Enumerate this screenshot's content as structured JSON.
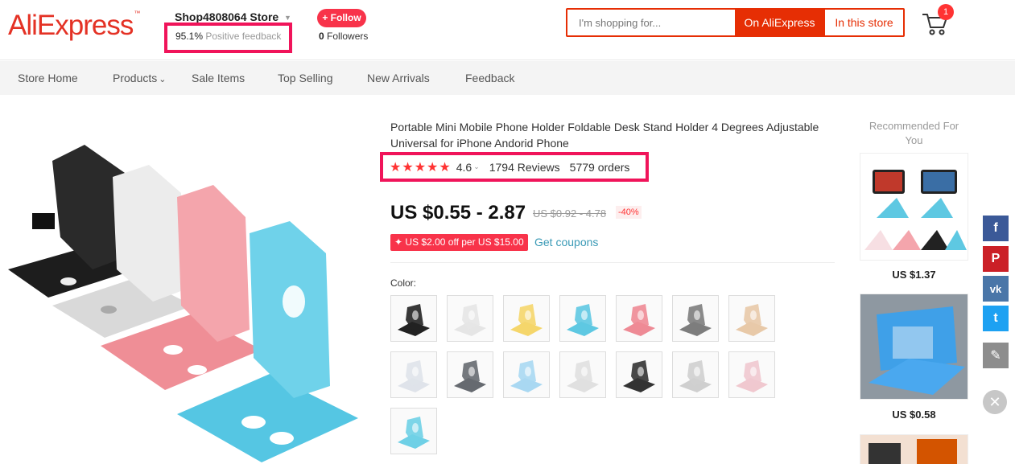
{
  "header": {
    "logo_text": "AliExpress",
    "logo_tm": "™",
    "store_name": "Shop4808064 Store",
    "feedback_pct": "95.1%",
    "feedback_label": "Positive feedback",
    "follow_label": "+ Follow",
    "followers_count": "0",
    "followers_label": "Followers",
    "search_placeholder": "I'm shopping for...",
    "search_btn_site": "On AliExpress",
    "search_btn_store": "In this store",
    "cart_count": "1"
  },
  "nav": {
    "items": [
      {
        "label": "Store Home"
      },
      {
        "label": "Products"
      },
      {
        "label": "Sale Items"
      },
      {
        "label": "Top Selling"
      },
      {
        "label": "New Arrivals"
      },
      {
        "label": "Feedback"
      }
    ]
  },
  "product": {
    "title": "Portable Mini Mobile Phone Holder Foldable Desk Stand Holder 4 Degrees Adjustable Universal for iPhone Andorid Phone",
    "stars": "★★★★★",
    "rating": "4.6",
    "rating_value": 4.6,
    "reviews": "1794 Reviews",
    "orders": "5779 orders",
    "price": "US $0.55 - 2.87",
    "old_price": "US $0.92 - 4.78",
    "discount": "-40%",
    "coupon": "US $2.00 off per US $15.00",
    "coupon_icon": "✦",
    "get_coupons": "Get coupons",
    "color_label": "Color:",
    "swatch_colors": [
      "#222222",
      "#e5e5e5",
      "#f5d66b",
      "#5ec8e2",
      "#ee8a95",
      "#7d7d7d",
      "#e8c9a8",
      "#dfe3ea",
      "#666a70",
      "#a9d8f2",
      "#e0e0e0",
      "#333333",
      "#cfcfcf",
      "#f0c8cf",
      "#6fd0e6"
    ]
  },
  "recommended": {
    "title": "Recommended For You",
    "items": [
      {
        "price": "US $1.37"
      },
      {
        "price": "US $0.58"
      }
    ]
  },
  "share": {
    "facebook": "f",
    "pinterest": "P",
    "vk": "vk",
    "twitter": "t",
    "edit": "✎",
    "close": "✕"
  },
  "colors": {
    "brand_red": "#e62e04",
    "highlight": "#f0145a",
    "facebook": "#3b5998",
    "pinterest": "#cb2027",
    "vk": "#4a76a8",
    "twitter": "#1da1f2"
  }
}
